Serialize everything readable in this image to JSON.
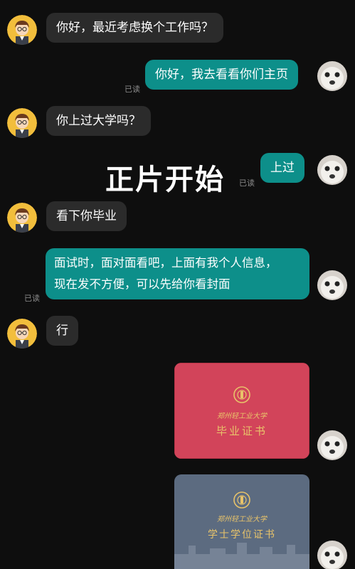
{
  "messages": [
    {
      "text": "你好，最近考虑换个工作吗？"
    },
    {
      "text": "你好，我去看看你们主页",
      "read": "已读"
    },
    {
      "text": "你上过大学吗？"
    },
    {
      "text": "上过",
      "read": "已读"
    },
    {
      "text": "看下你毕业"
    },
    {
      "line1": "面试时，面对面看吧，上面有我个人信息，",
      "line2": "现在发不方便，可以先给你看封面",
      "read": "已读"
    },
    {
      "text": "行"
    }
  ],
  "overlay_caption": "正片开始",
  "cert_red": {
    "school": "郑州轻工业大学",
    "title": "毕业证书",
    "color": "#d2445a"
  },
  "cert_blue": {
    "school": "郑州轻工业大学",
    "title": "学士学位证书",
    "color": "#5c6b80"
  },
  "colors": {
    "outgoing": "#0d8f8a",
    "incoming": "#2b2b2b",
    "background": "#0e0e0e"
  }
}
